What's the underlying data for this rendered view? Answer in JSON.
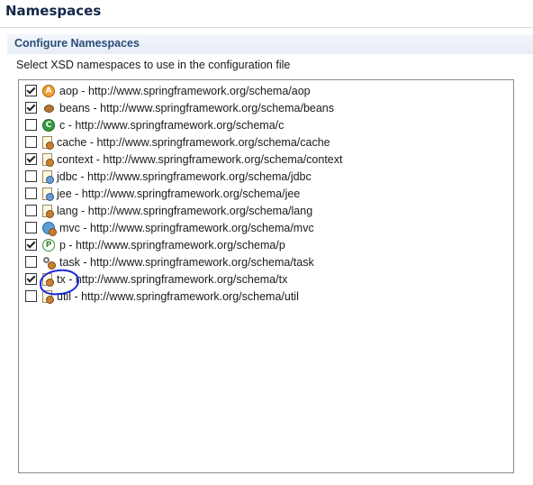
{
  "header": {
    "title": "Namespaces"
  },
  "section": {
    "title": "Configure Namespaces",
    "description": "Select XSD namespaces to use in the configuration file"
  },
  "namespaces": [
    {
      "label": "aop - http://www.springframework.org/schema/aop",
      "checked": true,
      "icon": "aop-icon"
    },
    {
      "label": "beans - http://www.springframework.org/schema/beans",
      "checked": true,
      "icon": "bean-icon"
    },
    {
      "label": "c - http://www.springframework.org/schema/c",
      "checked": false,
      "icon": "c-namespace-icon"
    },
    {
      "label": "cache - http://www.springframework.org/schema/cache",
      "checked": false,
      "icon": "document-icon"
    },
    {
      "label": "context - http://www.springframework.org/schema/context",
      "checked": true,
      "icon": "document-icon"
    },
    {
      "label": "jdbc - http://www.springframework.org/schema/jdbc",
      "checked": false,
      "icon": "document-icon"
    },
    {
      "label": "jee - http://www.springframework.org/schema/jee",
      "checked": false,
      "icon": "document-icon"
    },
    {
      "label": "lang - http://www.springframework.org/schema/lang",
      "checked": false,
      "icon": "document-icon"
    },
    {
      "label": "mvc - http://www.springframework.org/schema/mvc",
      "checked": false,
      "icon": "globe-icon"
    },
    {
      "label": "p - http://www.springframework.org/schema/p",
      "checked": true,
      "icon": "p-namespace-icon"
    },
    {
      "label": "task - http://www.springframework.org/schema/task",
      "checked": false,
      "icon": "gear-icon"
    },
    {
      "label": "tx - http://www.springframework.org/schema/tx",
      "checked": true,
      "icon": "document-icon"
    },
    {
      "label": "util - http://www.springframework.org/schema/util",
      "checked": false,
      "icon": "document-icon"
    }
  ]
}
